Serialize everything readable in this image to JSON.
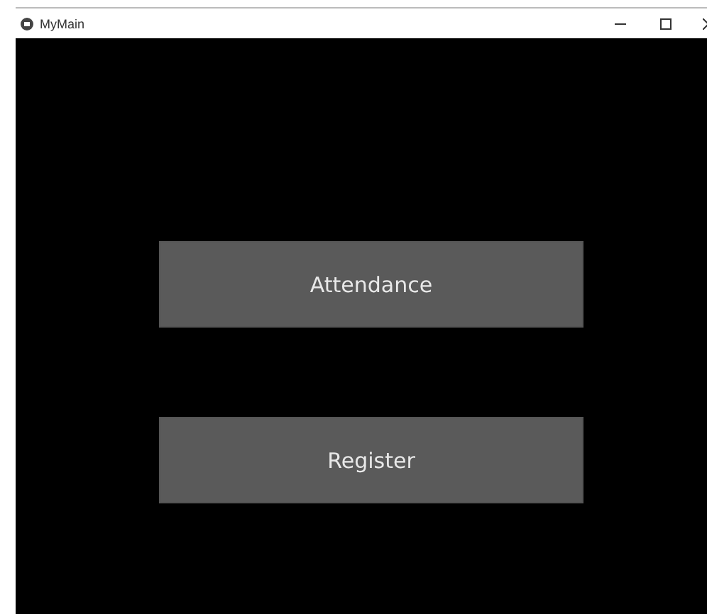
{
  "window": {
    "title": "MyMain"
  },
  "buttons": [
    {
      "label": "Attendance"
    },
    {
      "label": "Register"
    }
  ]
}
